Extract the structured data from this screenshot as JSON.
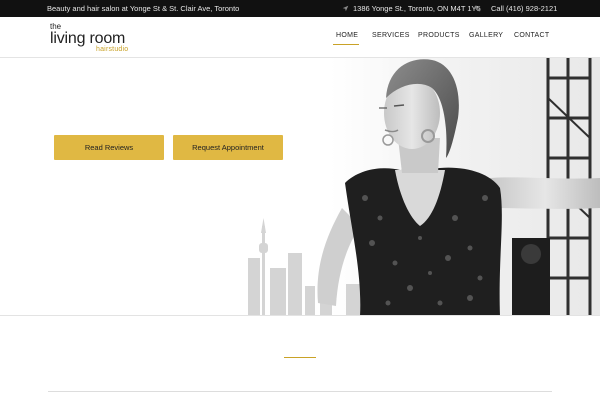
{
  "topbar": {
    "tagline": "Beauty and hair salon at Yonge St & St. Clair Ave, Toronto",
    "address": "1386 Yonge St., Toronto, ON M4T 1Y5",
    "phone": "Call (416) 928-2121",
    "icons": {
      "address": "location-arrow-icon",
      "phone": "phone-icon"
    }
  },
  "logo": {
    "line1": "the",
    "line2": "living room",
    "line3": "hairstudio"
  },
  "nav": {
    "items": [
      {
        "label": "HOME",
        "active": true
      },
      {
        "label": "SERVICES",
        "active": false
      },
      {
        "label": "PRODUCTS",
        "active": false
      },
      {
        "label": "GALLERY",
        "active": false
      },
      {
        "label": "CONTACT",
        "active": false
      }
    ]
  },
  "hero": {
    "buttons": {
      "reviews": "Read Reviews",
      "appointment": "Request Appointment"
    }
  },
  "colors": {
    "accent": "#e0b843",
    "topbar": "#111111",
    "logo_sub": "#c9a227"
  }
}
